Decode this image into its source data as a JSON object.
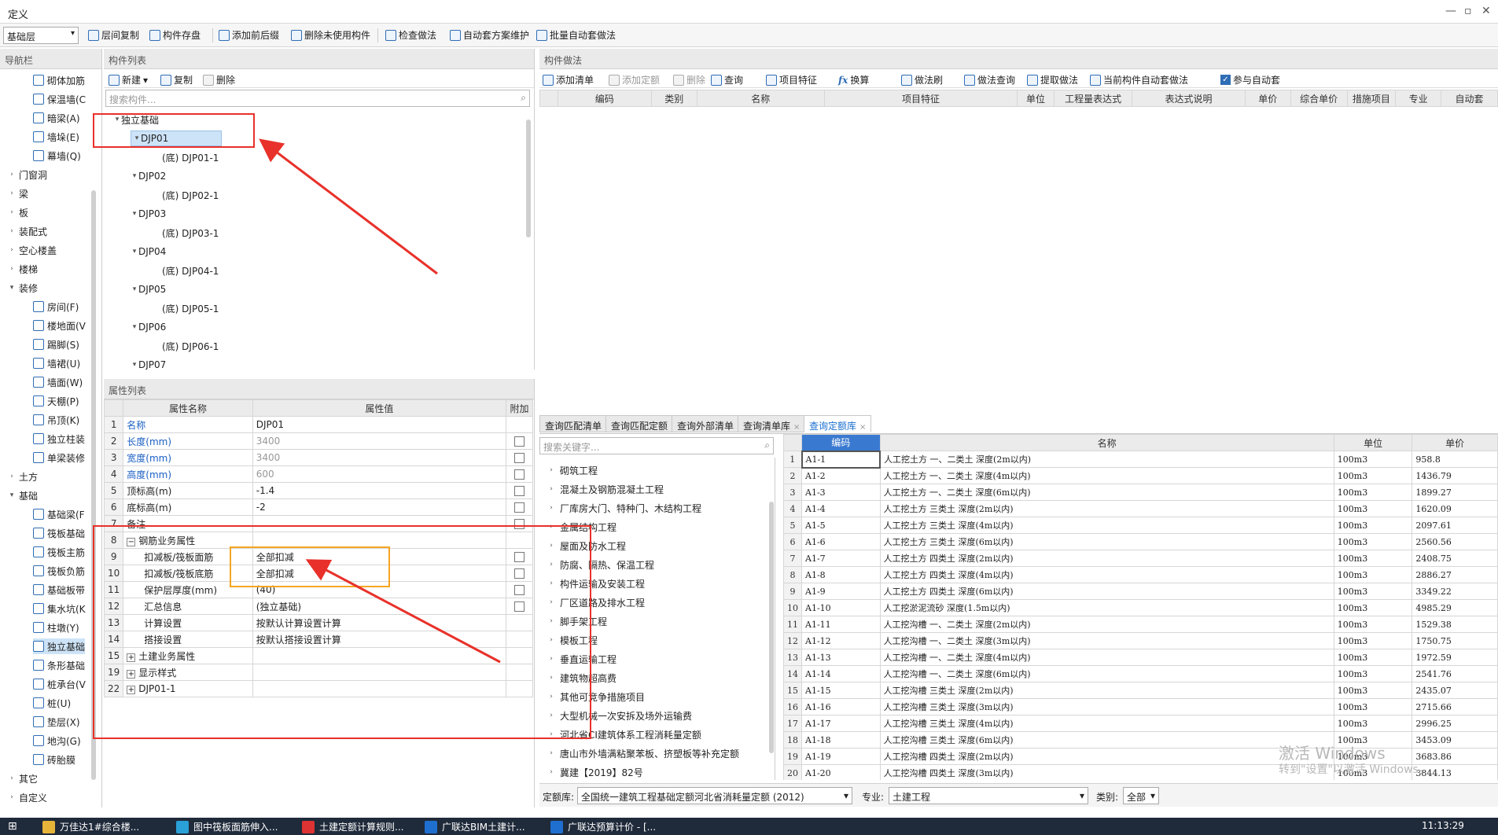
{
  "window": {
    "title": "定义"
  },
  "toolbar": {
    "floor_select": "基础层",
    "buttons": [
      "层间复制",
      "构件存盘",
      "添加前后缀",
      "删除未使用构件",
      "检查做法",
      "自动套方案维护",
      "批量自动套做法"
    ]
  },
  "nav": {
    "header": "导航栏",
    "items": [
      {
        "label": "砌体加筋",
        "level": 2,
        "icon": "wall-rebar-icon"
      },
      {
        "label": "保温墙(C",
        "level": 2,
        "icon": "insulation-wall-icon"
      },
      {
        "label": "暗梁(A)",
        "level": 2,
        "icon": "hidden-beam-icon"
      },
      {
        "label": "墙垛(E)",
        "level": 2,
        "icon": "wall-pier-icon"
      },
      {
        "label": "幕墙(Q)",
        "level": 2,
        "icon": "curtain-wall-icon"
      },
      {
        "label": "门窗洞",
        "level": 1
      },
      {
        "label": "梁",
        "level": 1
      },
      {
        "label": "板",
        "level": 1
      },
      {
        "label": "装配式",
        "level": 1
      },
      {
        "label": "空心楼盖",
        "level": 1
      },
      {
        "label": "楼梯",
        "level": 1
      },
      {
        "label": "装修",
        "level": 1,
        "expanded": true
      },
      {
        "label": "房间(F)",
        "level": 2,
        "icon": "room-icon"
      },
      {
        "label": "楼地面(V",
        "level": 2,
        "icon": "floor-icon"
      },
      {
        "label": "踢脚(S)",
        "level": 2,
        "icon": "skirting-icon"
      },
      {
        "label": "墙裙(U)",
        "level": 2,
        "icon": "dado-icon"
      },
      {
        "label": "墙面(W)",
        "level": 2,
        "icon": "wall-surface-icon"
      },
      {
        "label": "天棚(P)",
        "level": 2,
        "icon": "ceiling-icon"
      },
      {
        "label": "吊顶(K)",
        "level": 2,
        "icon": "suspended-ceiling-icon"
      },
      {
        "label": "独立柱装",
        "level": 2,
        "icon": "column-finish-icon"
      },
      {
        "label": "单梁装修",
        "level": 2,
        "icon": "beam-finish-icon"
      },
      {
        "label": "土方",
        "level": 1
      },
      {
        "label": "基础",
        "level": 1,
        "expanded": true
      },
      {
        "label": "基础梁(F",
        "level": 2,
        "icon": "foundation-beam-icon"
      },
      {
        "label": "筏板基础",
        "level": 2,
        "icon": "raft-foundation-icon"
      },
      {
        "label": "筏板主筋",
        "level": 2,
        "icon": "raft-main-rebar-icon"
      },
      {
        "label": "筏板负筋",
        "level": 2,
        "icon": "raft-neg-rebar-icon"
      },
      {
        "label": "基础板带",
        "level": 2,
        "icon": "foundation-strip-icon"
      },
      {
        "label": "集水坑(K",
        "level": 2,
        "icon": "sump-icon"
      },
      {
        "label": "柱墩(Y)",
        "level": 2,
        "icon": "column-pier-icon"
      },
      {
        "label": "独立基础",
        "level": 2,
        "icon": "isolated-foundation-icon",
        "selected": true
      },
      {
        "label": "条形基础",
        "level": 2,
        "icon": "strip-foundation-icon"
      },
      {
        "label": "桩承台(V",
        "level": 2,
        "icon": "pile-cap-icon"
      },
      {
        "label": "桩(U)",
        "level": 2,
        "icon": "pile-icon"
      },
      {
        "label": "垫层(X)",
        "level": 2,
        "icon": "cushion-icon"
      },
      {
        "label": "地沟(G)",
        "level": 2,
        "icon": "trench-icon"
      },
      {
        "label": "砖胎膜",
        "level": 2,
        "icon": "brick-mold-icon"
      },
      {
        "label": "其它",
        "level": 1
      },
      {
        "label": "自定义",
        "level": 1
      }
    ]
  },
  "complist": {
    "header": "构件列表",
    "buttons": [
      "新建",
      "复制",
      "删除"
    ],
    "search_placeholder": "搜索构件...",
    "tree": [
      {
        "label": "独立基础",
        "level": 0
      },
      {
        "label": "DJP01",
        "level": 1,
        "selected": true
      },
      {
        "label": "(底) DJP01-1",
        "level": 2
      },
      {
        "label": "DJP02",
        "level": 1
      },
      {
        "label": "(底) DJP02-1",
        "level": 2
      },
      {
        "label": "DJP03",
        "level": 1
      },
      {
        "label": "(底) DJP03-1",
        "level": 2
      },
      {
        "label": "DJP04",
        "level": 1
      },
      {
        "label": "(底) DJP04-1",
        "level": 2
      },
      {
        "label": "DJP05",
        "level": 1
      },
      {
        "label": "(底) DJP05-1",
        "level": 2
      },
      {
        "label": "DJP06",
        "level": 1
      },
      {
        "label": "(底) DJP06-1",
        "level": 2
      },
      {
        "label": "DJP07",
        "level": 1
      }
    ]
  },
  "attrs": {
    "header": "属性列表",
    "columns": [
      "属性名称",
      "属性值",
      "附加"
    ],
    "rows": [
      {
        "n": "1",
        "name": "名称",
        "value": "DJP01",
        "blue": true,
        "cb": false
      },
      {
        "n": "2",
        "name": "长度(mm)",
        "value": "3400",
        "blue": true,
        "dim": true,
        "cb": true
      },
      {
        "n": "3",
        "name": "宽度(mm)",
        "value": "3400",
        "blue": true,
        "dim": true,
        "cb": true
      },
      {
        "n": "4",
        "name": "高度(mm)",
        "value": "600",
        "blue": true,
        "dim": true,
        "cb": true
      },
      {
        "n": "5",
        "name": "顶标高(m)",
        "value": "-1.4",
        "cb": true
      },
      {
        "n": "6",
        "name": "底标高(m)",
        "value": "-2",
        "cb": true
      },
      {
        "n": "7",
        "name": "备注",
        "value": "",
        "cb": true
      },
      {
        "n": "8",
        "name": "钢筋业务属性",
        "value": "",
        "group": "minus"
      },
      {
        "n": "9",
        "name": "扣减板/筏板面筋",
        "value": "全部扣减",
        "indent": true,
        "cb": true
      },
      {
        "n": "10",
        "name": "扣减板/筏板底筋",
        "value": "全部扣减",
        "indent": true,
        "cb": true
      },
      {
        "n": "11",
        "name": "保护层厚度(mm)",
        "value": "(40)",
        "indent": true,
        "cb": true
      },
      {
        "n": "12",
        "name": "汇总信息",
        "value": "(独立基础)",
        "indent": true,
        "cb": true
      },
      {
        "n": "13",
        "name": "计算设置",
        "value": "按默认计算设置计算",
        "indent": true
      },
      {
        "n": "14",
        "name": "搭接设置",
        "value": "按默认搭接设置计算",
        "indent": true
      },
      {
        "n": "15",
        "name": "土建业务属性",
        "value": "",
        "group": "plus"
      },
      {
        "n": "19",
        "name": "显示样式",
        "value": "",
        "group": "plus"
      },
      {
        "n": "22",
        "name": "DJP01-1",
        "value": "",
        "group": "plus"
      }
    ]
  },
  "method": {
    "header": "构件做法",
    "buttons": [
      "添加清单",
      "添加定额",
      "删除",
      "查询",
      "项目特征",
      "换算",
      "做法刷",
      "做法查询",
      "提取做法",
      "当前构件自动套做法",
      "参与自动套"
    ],
    "columns": [
      "编码",
      "类别",
      "名称",
      "项目特征",
      "单位",
      "工程量表达式",
      "表达式说明",
      "单价",
      "综合单价",
      "措施项目",
      "专业",
      "自动套"
    ]
  },
  "lower": {
    "tabs": [
      "查询匹配清单",
      "查询匹配定额",
      "查询外部清单",
      "查询清单库",
      "查询定额库"
    ],
    "search_placeholder": "搜索关键字...",
    "categories": [
      "砌筑工程",
      "混凝土及钢筋混凝土工程",
      "厂库房大门、特种门、木结构工程",
      "金属结构工程",
      "屋面及防水工程",
      "防腐、隔热、保温工程",
      "构件运输及安装工程",
      "厂区道路及排水工程",
      "脚手架工程",
      "模板工程",
      "垂直运输工程",
      "建筑物超高费",
      "其他可竞争措施项目",
      "大型机械一次安拆及场外运输费",
      "河北省CI建筑体系工程消耗量定额",
      "唐山市外墙满粘聚苯板、挤塑板等补充定额",
      "冀建【2019】82号"
    ],
    "quota_columns": [
      "编码",
      "名称",
      "单位",
      "单价"
    ],
    "quota_rows": [
      [
        "1",
        "A1-1",
        "人工挖土方 一、二类土 深度(2m以内)",
        "100m3",
        "958.8"
      ],
      [
        "2",
        "A1-2",
        "人工挖土方 一、二类土 深度(4m以内)",
        "100m3",
        "1436.79"
      ],
      [
        "3",
        "A1-3",
        "人工挖土方 一、二类土 深度(6m以内)",
        "100m3",
        "1899.27"
      ],
      [
        "4",
        "A1-4",
        "人工挖土方 三类土 深度(2m以内)",
        "100m3",
        "1620.09"
      ],
      [
        "5",
        "A1-5",
        "人工挖土方 三类土 深度(4m以内)",
        "100m3",
        "2097.61"
      ],
      [
        "6",
        "A1-6",
        "人工挖土方 三类土 深度(6m以内)",
        "100m3",
        "2560.56"
      ],
      [
        "7",
        "A1-7",
        "人工挖土方 四类土 深度(2m以内)",
        "100m3",
        "2408.75"
      ],
      [
        "8",
        "A1-8",
        "人工挖土方 四类土 深度(4m以内)",
        "100m3",
        "2886.27"
      ],
      [
        "9",
        "A1-9",
        "人工挖土方 四类土 深度(6m以内)",
        "100m3",
        "3349.22"
      ],
      [
        "10",
        "A1-10",
        "人工挖淤泥流砂 深度(1.5m以内)",
        "100m3",
        "4985.29"
      ],
      [
        "11",
        "A1-11",
        "人工挖沟槽 一、二类土 深度(2m以内)",
        "100m3",
        "1529.38"
      ],
      [
        "12",
        "A1-12",
        "人工挖沟槽 一、二类土 深度(3m以内)",
        "100m3",
        "1750.75"
      ],
      [
        "13",
        "A1-13",
        "人工挖沟槽 一、二类土 深度(4m以内)",
        "100m3",
        "1972.59"
      ],
      [
        "14",
        "A1-14",
        "人工挖沟槽 一、二类土 深度(6m以内)",
        "100m3",
        "2541.76"
      ],
      [
        "15",
        "A1-15",
        "人工挖沟槽 三类土 深度(2m以内)",
        "100m3",
        "2435.07"
      ],
      [
        "16",
        "A1-16",
        "人工挖沟槽 三类土 深度(3m以内)",
        "100m3",
        "2715.66"
      ],
      [
        "17",
        "A1-17",
        "人工挖沟槽 三类土 深度(4m以内)",
        "100m3",
        "2996.25"
      ],
      [
        "18",
        "A1-18",
        "人工挖沟槽 三类土 深度(6m以内)",
        "100m3",
        "3453.09"
      ],
      [
        "19",
        "A1-19",
        "人工挖沟槽 四类土 深度(2m以内)",
        "100m3",
        "3683.86"
      ],
      [
        "20",
        "A1-20",
        "人工挖沟槽 四类土 深度(3m以内)",
        "100m3",
        "3844.13"
      ]
    ],
    "bottom": {
      "quota_lib_label": "定额库:",
      "quota_lib_value": "全国统一建筑工程基础定额河北省消耗量定额 (2012)",
      "major_label": "专业:",
      "major_value": "土建工程",
      "type_label": "类别:",
      "type_value": "全部"
    }
  },
  "watermark": {
    "line1": "激活 Windows",
    "line2": "转到\"设置\"以激活 Windows。"
  },
  "taskbar": {
    "items": [
      "万佳达1#综合楼...",
      "图中筏板面筋伸入...",
      "土建定额计算规则...",
      "广联达BIM土建计...",
      "广联达预算计价 - [..."
    ],
    "clock": "11:13:29"
  }
}
